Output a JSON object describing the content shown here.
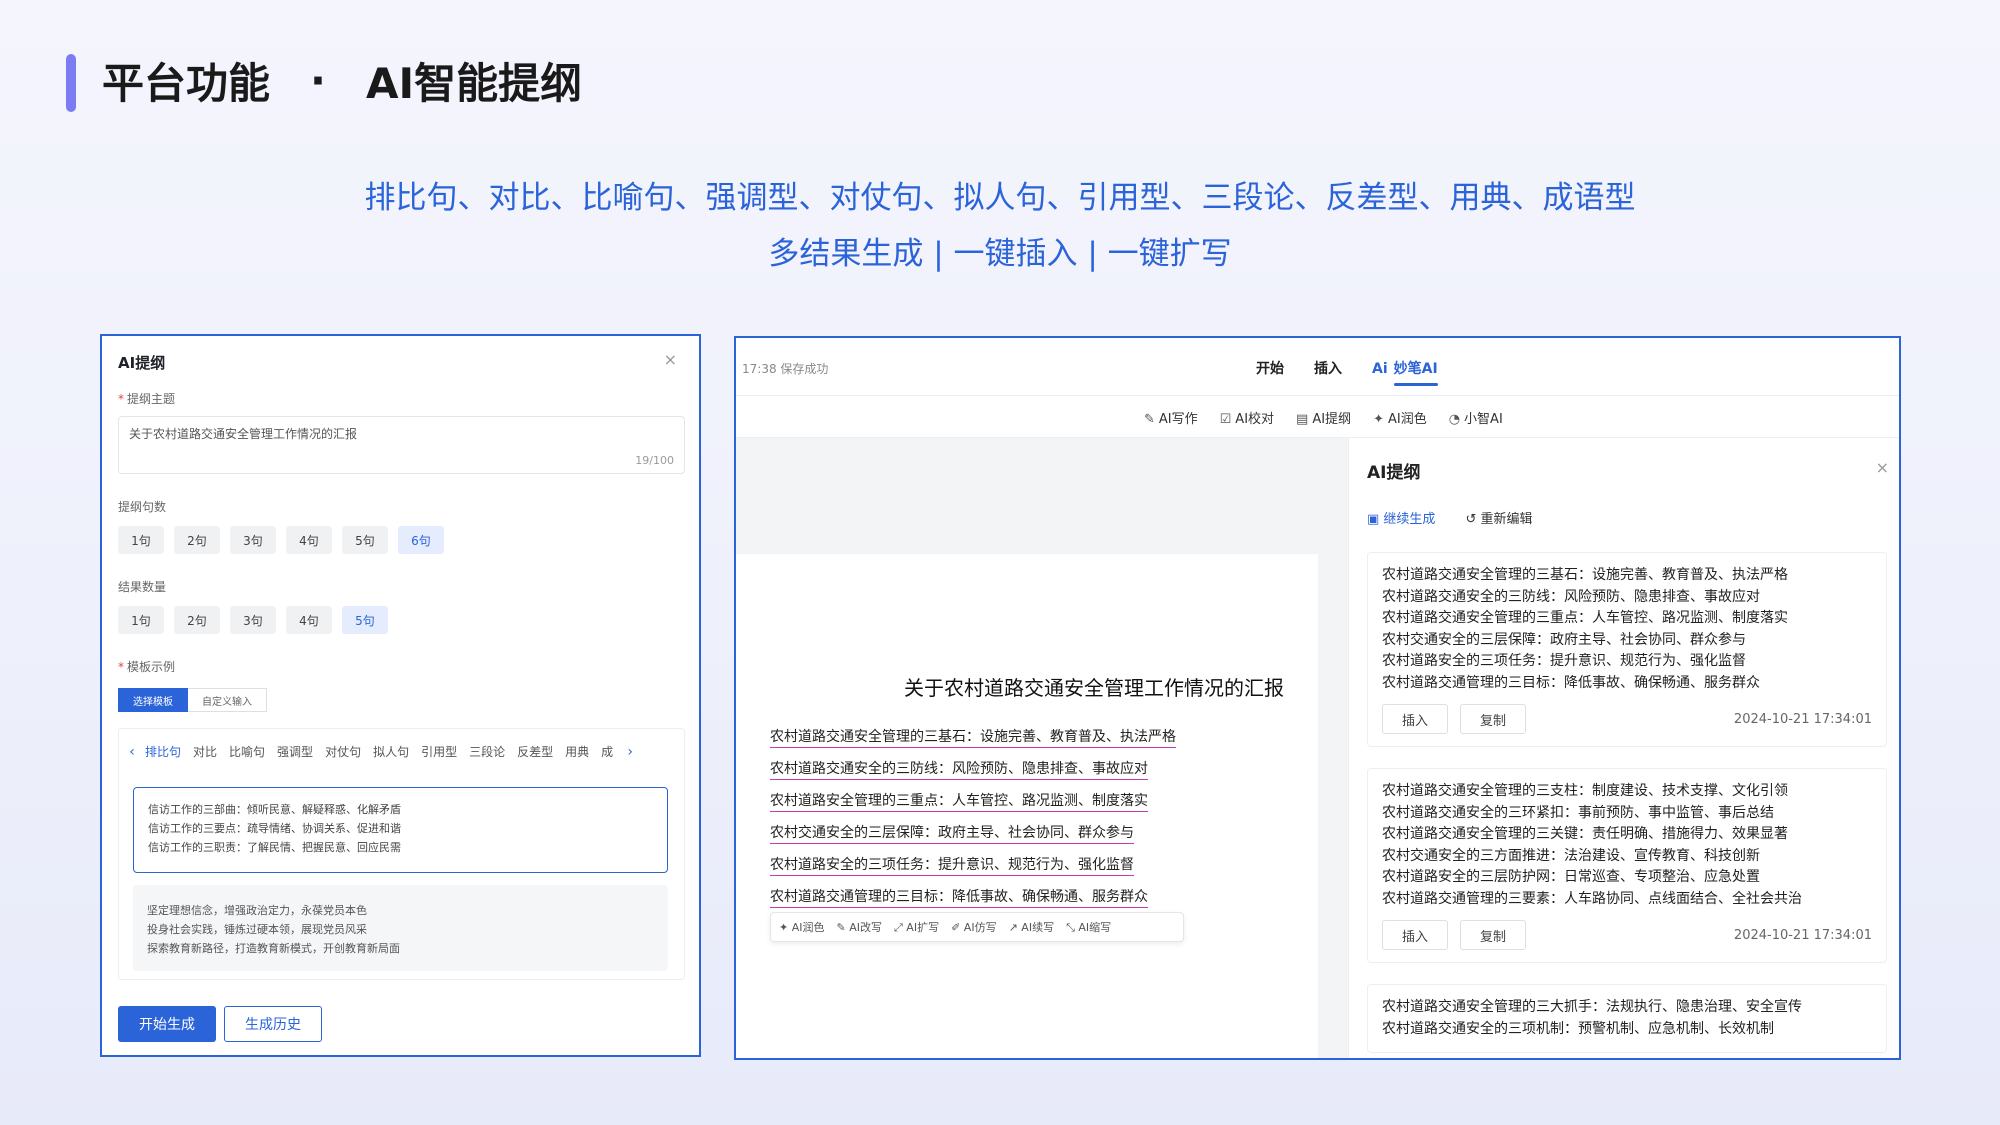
{
  "header": {
    "section": "平台功能",
    "separator": "·",
    "feature": "AI智能提纲",
    "line1": "排比句、对比、比喻句、强调型、对仗句、拟人句、引用型、三段论、反差型、用典、成语型",
    "line2": "多结果生成 | 一键插入 | 一键扩写"
  },
  "left_panel": {
    "title": "AI提纲",
    "close": "×",
    "topic_label": "提纲主题",
    "topic_required": "*",
    "topic_value": "关于农村道路交通安全管理工作情况的汇报",
    "topic_count": "19/100",
    "sentence_label": "提纲句数",
    "sentence_options": [
      "1句",
      "2句",
      "3句",
      "4句",
      "5句",
      "6句"
    ],
    "sentence_selected": "6句",
    "result_label": "结果数量",
    "result_options": [
      "1句",
      "2句",
      "3句",
      "4句",
      "5句"
    ],
    "result_selected": "5句",
    "template_label": "模板示例",
    "template_required": "*",
    "template_tabs": [
      "选择模板",
      "自定义输入"
    ],
    "categories": [
      "排比句",
      "对比",
      "比喻句",
      "强调型",
      "对仗句",
      "拟人句",
      "引用型",
      "三段论",
      "反差型",
      "用典",
      "成"
    ],
    "category_selected": "排比句",
    "example1": [
      "信访工作的三部曲：倾听民意、解疑释惑、化解矛盾",
      "信访工作的三要点：疏导情绪、协调关系、促进和谐",
      "信访工作的三职责：了解民情、把握民意、回应民需"
    ],
    "example2": [
      "坚定理想信念，增强政治定力，永葆党员本色",
      "投身社会实践，锤炼过硬本领，展现党员风采",
      "探索教育新路径，打造教育新模式，开创教育新局面"
    ],
    "start_button": "开始生成",
    "history_button": "生成历史"
  },
  "editor": {
    "save_status": "17:38 保存成功",
    "tabs": [
      "开始",
      "插入",
      "妙笔AI"
    ],
    "tab_selected": "妙笔AI",
    "tab_ai_prefix": "Ai",
    "tools": [
      "AI写作",
      "AI校对",
      "AI提纲",
      "AI润色",
      "小智AI"
    ],
    "doc_title": "关于农村道路交通安全管理工作情况的汇报",
    "doc_lines": [
      "农村道路交通安全管理的三基石：设施完善、教育普及、执法严格",
      "农村道路交通安全的三防线：风险预防、隐患排查、事故应对",
      "农村道路安全管理的三重点：人车管控、路况监测、制度落实",
      "农村交通安全的三层保障：政府主导、社会协同、群众参与",
      "农村道路安全的三项任务：提升意识、规范行为、强化监督",
      "农村道路交通管理的三目标：降低事故、确保畅通、服务群众"
    ],
    "mini_tools": [
      "AI润色",
      "AI改写",
      "AI扩写",
      "AI仿写",
      "AI续写",
      "AI缩写"
    ]
  },
  "side_panel": {
    "title": "AI提纲",
    "close": "×",
    "continue": "继续生成",
    "reedit": "重新编辑",
    "insert": "插入",
    "copy": "复制",
    "cards": [
      {
        "lines": [
          "农村道路交通安全管理的三基石：设施完善、教育普及、执法严格",
          "农村道路交通安全的三防线：风险预防、隐患排查、事故应对",
          "农村道路交通安全管理的三重点：人车管控、路况监测、制度落实",
          "农村交通安全的三层保障：政府主导、社会协同、群众参与",
          "农村道路安全的三项任务：提升意识、规范行为、强化监督",
          "农村道路交通管理的三目标：降低事故、确保畅通、服务群众"
        ],
        "time": "2024-10-21 17:34:01"
      },
      {
        "lines": [
          "农村道路交通安全管理的三支柱：制度建设、技术支撑、文化引领",
          "农村道路交通安全的三环紧扣：事前预防、事中监管、事后总结",
          "农村道路交通安全管理的三关键：责任明确、措施得力、效果显著",
          "农村交通安全的三方面推进：法治建设、宣传教育、科技创新",
          "农村道路安全的三层防护网：日常巡查、专项整治、应急处置",
          "农村道路交通管理的三要素：人车路协同、点线面结合、全社会共治"
        ],
        "time": "2024-10-21 17:34:01"
      },
      {
        "lines": [
          "农村道路交通安全管理的三大抓手：法规执行、隐患治理、安全宣传",
          "农村道路交通安全的三项机制：预警机制、应急机制、长效机制"
        ],
        "time": ""
      }
    ]
  }
}
